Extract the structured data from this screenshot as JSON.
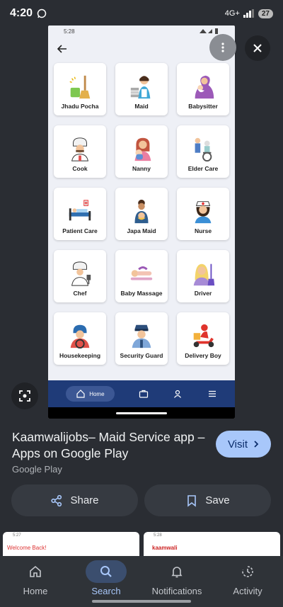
{
  "status_bar": {
    "time": "4:20",
    "network": "4G+",
    "battery": "27"
  },
  "preview": {
    "status_time": "5:28",
    "services": [
      {
        "label": "Jhadu Pocha",
        "icon": "broom-icon"
      },
      {
        "label": "Maid",
        "icon": "maid-icon"
      },
      {
        "label": "Babysitter",
        "icon": "babysitter-icon"
      },
      {
        "label": "Cook",
        "icon": "chef-hat-icon"
      },
      {
        "label": "Nanny",
        "icon": "nanny-icon"
      },
      {
        "label": "Elder Care",
        "icon": "wheelchair-icon"
      },
      {
        "label": "Patient Care",
        "icon": "hospital-bed-icon"
      },
      {
        "label": "Japa Maid",
        "icon": "mother-baby-icon"
      },
      {
        "label": "Nurse",
        "icon": "nurse-icon"
      },
      {
        "label": "Chef",
        "icon": "chef-icon"
      },
      {
        "label": "Baby Massage",
        "icon": "massage-icon"
      },
      {
        "label": "Driver",
        "icon": "driver-icon"
      },
      {
        "label": "Housekeeping",
        "icon": "housekeeping-icon"
      },
      {
        "label": "Security Guard",
        "icon": "guard-icon"
      },
      {
        "label": "Delivery Boy",
        "icon": "scooter-icon"
      }
    ],
    "nav": {
      "home_label": "Home"
    }
  },
  "result": {
    "title": "Kaamwalijobs– Maid Service app – Apps on Google Play",
    "source": "Google Play",
    "visit_label": "Visit",
    "share_label": "Share",
    "save_label": "Save"
  },
  "thumbnails": [
    {
      "time": "5:27",
      "text": "Welcome Back!"
    },
    {
      "time": "5:28",
      "text": "kaamwali"
    }
  ],
  "bottom_nav": [
    {
      "label": "Home",
      "icon": "home-icon",
      "active": false
    },
    {
      "label": "Search",
      "icon": "search-icon",
      "active": true
    },
    {
      "label": "Notifications",
      "icon": "bell-icon",
      "active": false
    },
    {
      "label": "Activity",
      "icon": "activity-icon",
      "active": false
    }
  ],
  "colors": {
    "accent": "#a8c7fa",
    "preview_nav": "#1f3b78",
    "background": "#2a2d33"
  }
}
